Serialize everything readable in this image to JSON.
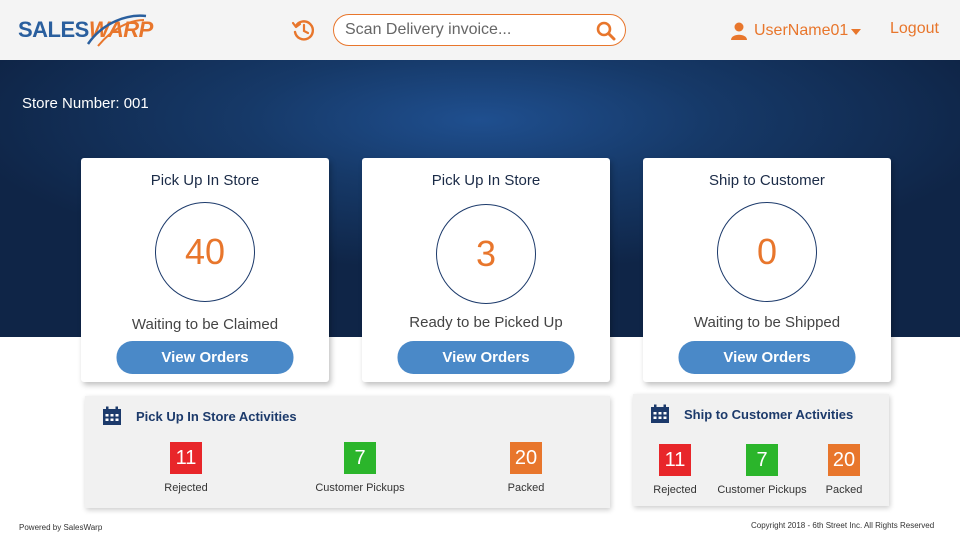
{
  "header": {
    "logo": {
      "part1": "SALES",
      "part2": "WARP"
    },
    "history_icon": "history-icon",
    "search": {
      "placeholder": "Scan Delivery invoice...",
      "value": "",
      "icon": "search-icon"
    },
    "user": {
      "name": "UserName01",
      "icon": "user-icon",
      "caret": "caret-down-icon"
    },
    "logout": "Logout"
  },
  "store_number": "Store Number: 001",
  "cards": [
    {
      "title": "Pick Up In Store",
      "count": "40",
      "caption": "Waiting to be Claimed",
      "button": "View Orders"
    },
    {
      "title": "Pick Up In Store",
      "count": "3",
      "caption": "Ready to be Picked Up",
      "button": "View Orders"
    },
    {
      "title": "Ship to Customer",
      "count": "0",
      "caption": "Waiting to be Shipped",
      "button": "View Orders"
    }
  ],
  "activities": {
    "pickup": {
      "title": "Pick Up In Store Activities",
      "stats": [
        {
          "value": "11",
          "label": "Rejected",
          "color": "#e8262a"
        },
        {
          "value": "7",
          "label": "Customer Pickups",
          "color": "#2bb52b"
        },
        {
          "value": "20",
          "label": "Packed",
          "color": "#e8762c"
        }
      ]
    },
    "ship": {
      "title": "Ship to Customer Activities",
      "stats": [
        {
          "value": "11",
          "label": "Rejected",
          "color": "#e8262a"
        },
        {
          "value": "7",
          "label": "Customer Pickups",
          "color": "#2bb52b"
        },
        {
          "value": "20",
          "label": "Packed",
          "color": "#e8762c"
        }
      ]
    }
  },
  "footer": {
    "powered": "Powered by SalesWarp",
    "copyright": "Copyright 2018 - 6th Street Inc. All Rights Reserved"
  },
  "colors": {
    "accent": "#e8762c",
    "navy": "#1c3a6b",
    "button": "#4a89c8"
  }
}
